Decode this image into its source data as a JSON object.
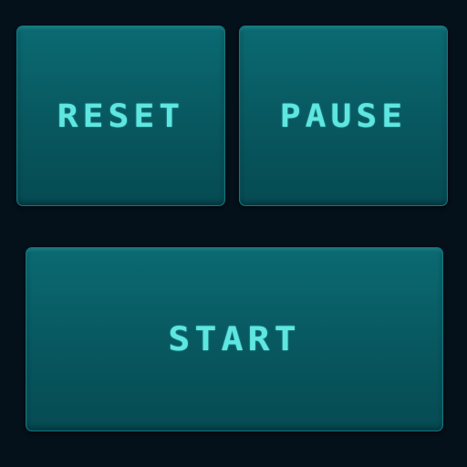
{
  "controls": {
    "reset_label": "RESET",
    "pause_label": "PAUSE",
    "start_label": "START"
  },
  "colors": {
    "background": "#04101a",
    "button_fill": "#08575f",
    "button_text": "#5ee6e0"
  }
}
